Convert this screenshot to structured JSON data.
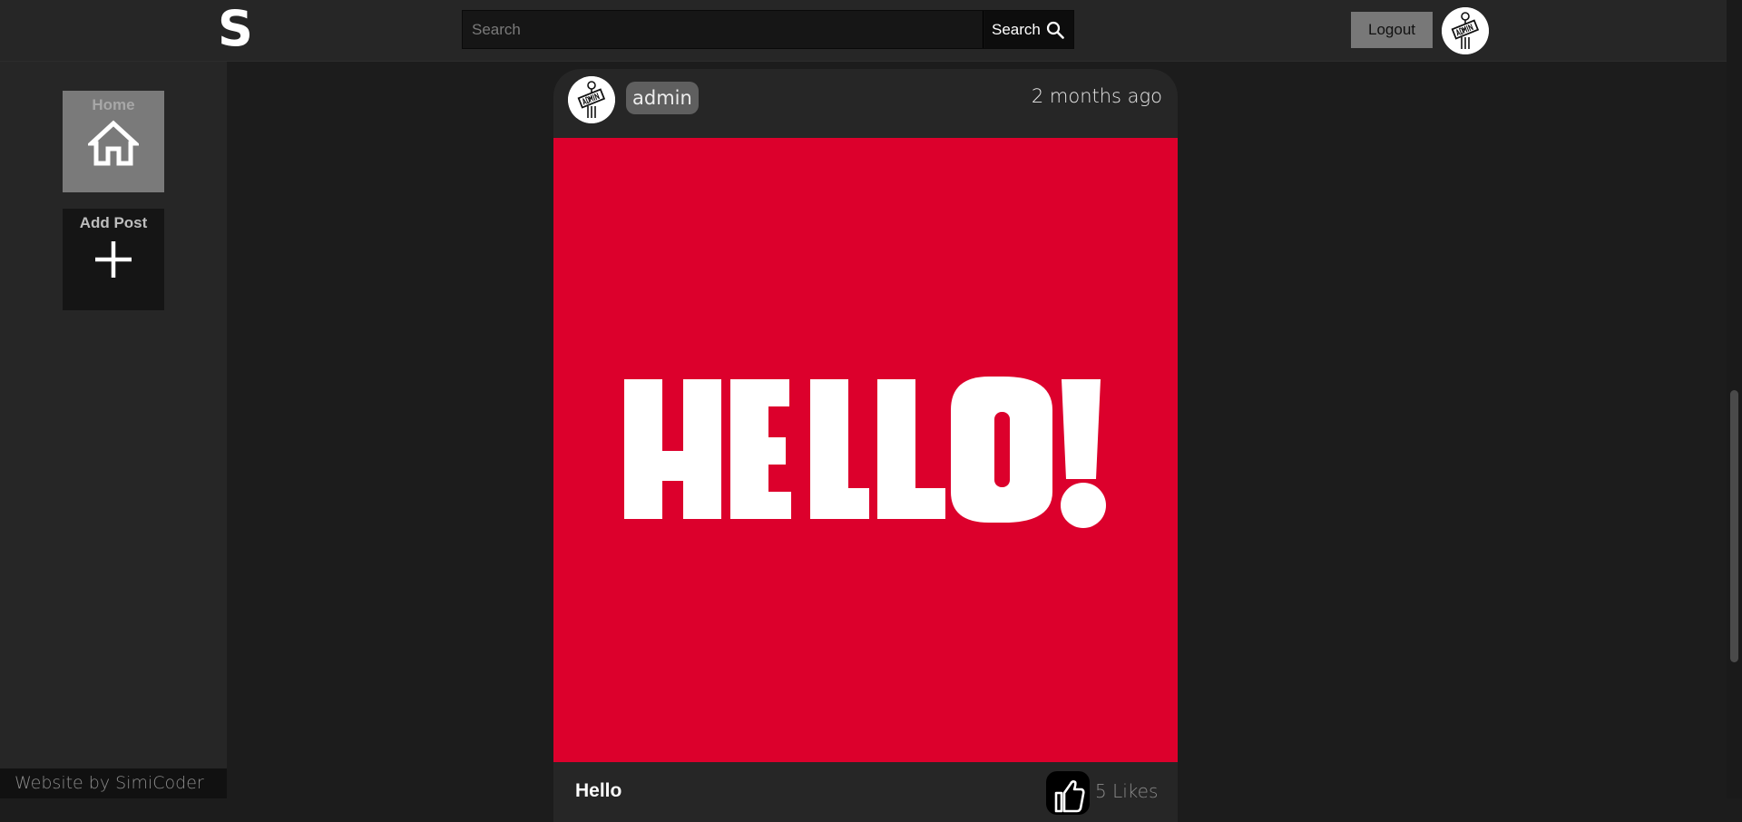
{
  "header": {
    "logo": "S",
    "search_placeholder": "Search",
    "search_button": "Search",
    "logout_button": "Logout",
    "avatar_icon": "admin-sign-avatar-icon"
  },
  "sidebar": {
    "items": [
      {
        "label": "Home",
        "icon": "home-icon",
        "active": true
      },
      {
        "label": "Add Post",
        "icon": "plus-icon",
        "active": false
      }
    ]
  },
  "footer": {
    "credit": "Website by SimiCoder"
  },
  "post": {
    "username": "admin",
    "time": "2 months ago",
    "image_text": "HELLO!",
    "title": "Hello",
    "likes": "5 Likes"
  },
  "colors": {
    "background": "#1c1c1c",
    "panel": "#262626",
    "image_red": "#dc002c",
    "active_item": "#7a7a7a"
  }
}
